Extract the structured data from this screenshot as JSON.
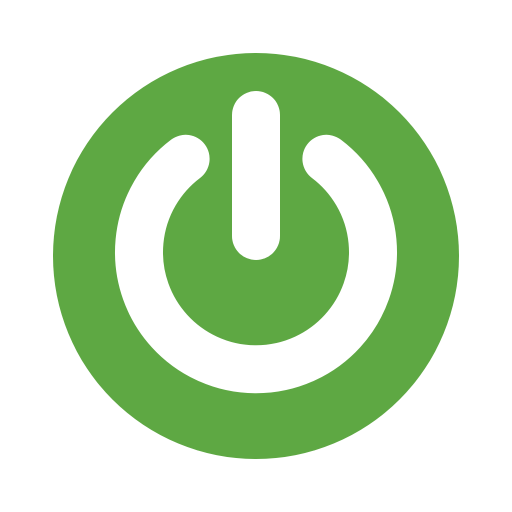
{
  "icon": {
    "name": "power-icon",
    "colors": {
      "disc": "#5ea843",
      "symbol": "#ffffff",
      "background": "#ffffff"
    }
  }
}
